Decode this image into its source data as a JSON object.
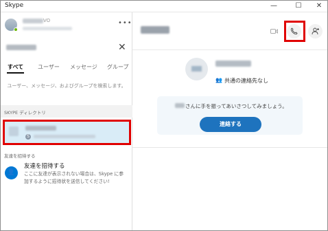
{
  "window": {
    "title": "Skype",
    "controls": {
      "minimize": "—",
      "maximize": "☐",
      "close": "✕"
    }
  },
  "me": {
    "status_text": "VO",
    "status_color": "#6bb700",
    "more_label": "•••"
  },
  "search": {
    "clear_icon": "✕"
  },
  "tabs": [
    {
      "label": "すべて",
      "active": true
    },
    {
      "label": "ユーザー",
      "active": false
    },
    {
      "label": "メッセージ",
      "active": false
    },
    {
      "label": "グループ",
      "active": false
    }
  ],
  "search_hint": "ユーザー、メッセージ、およびグループを検索します。",
  "directory": {
    "header": "SKYPE ディレクトリ",
    "item_badge": "S"
  },
  "invite": {
    "header": "友達を招待する",
    "title": "友達を招待する",
    "description": "ここに友達が表示されない場合は、Skype に参加するように招待状を送信してください!"
  },
  "conversation": {
    "header_buttons": {
      "video_icon": "video-camera-icon",
      "call_icon": "phone-icon",
      "add_icon": "add-person-icon"
    },
    "no_common_contacts": "共通の連絡先なし",
    "wave_text": "さんに手を振ってあいさつしてみましょう。",
    "connect_button": "連絡する",
    "accent_color": "#1e73be",
    "highlight_color": "#e00000"
  }
}
